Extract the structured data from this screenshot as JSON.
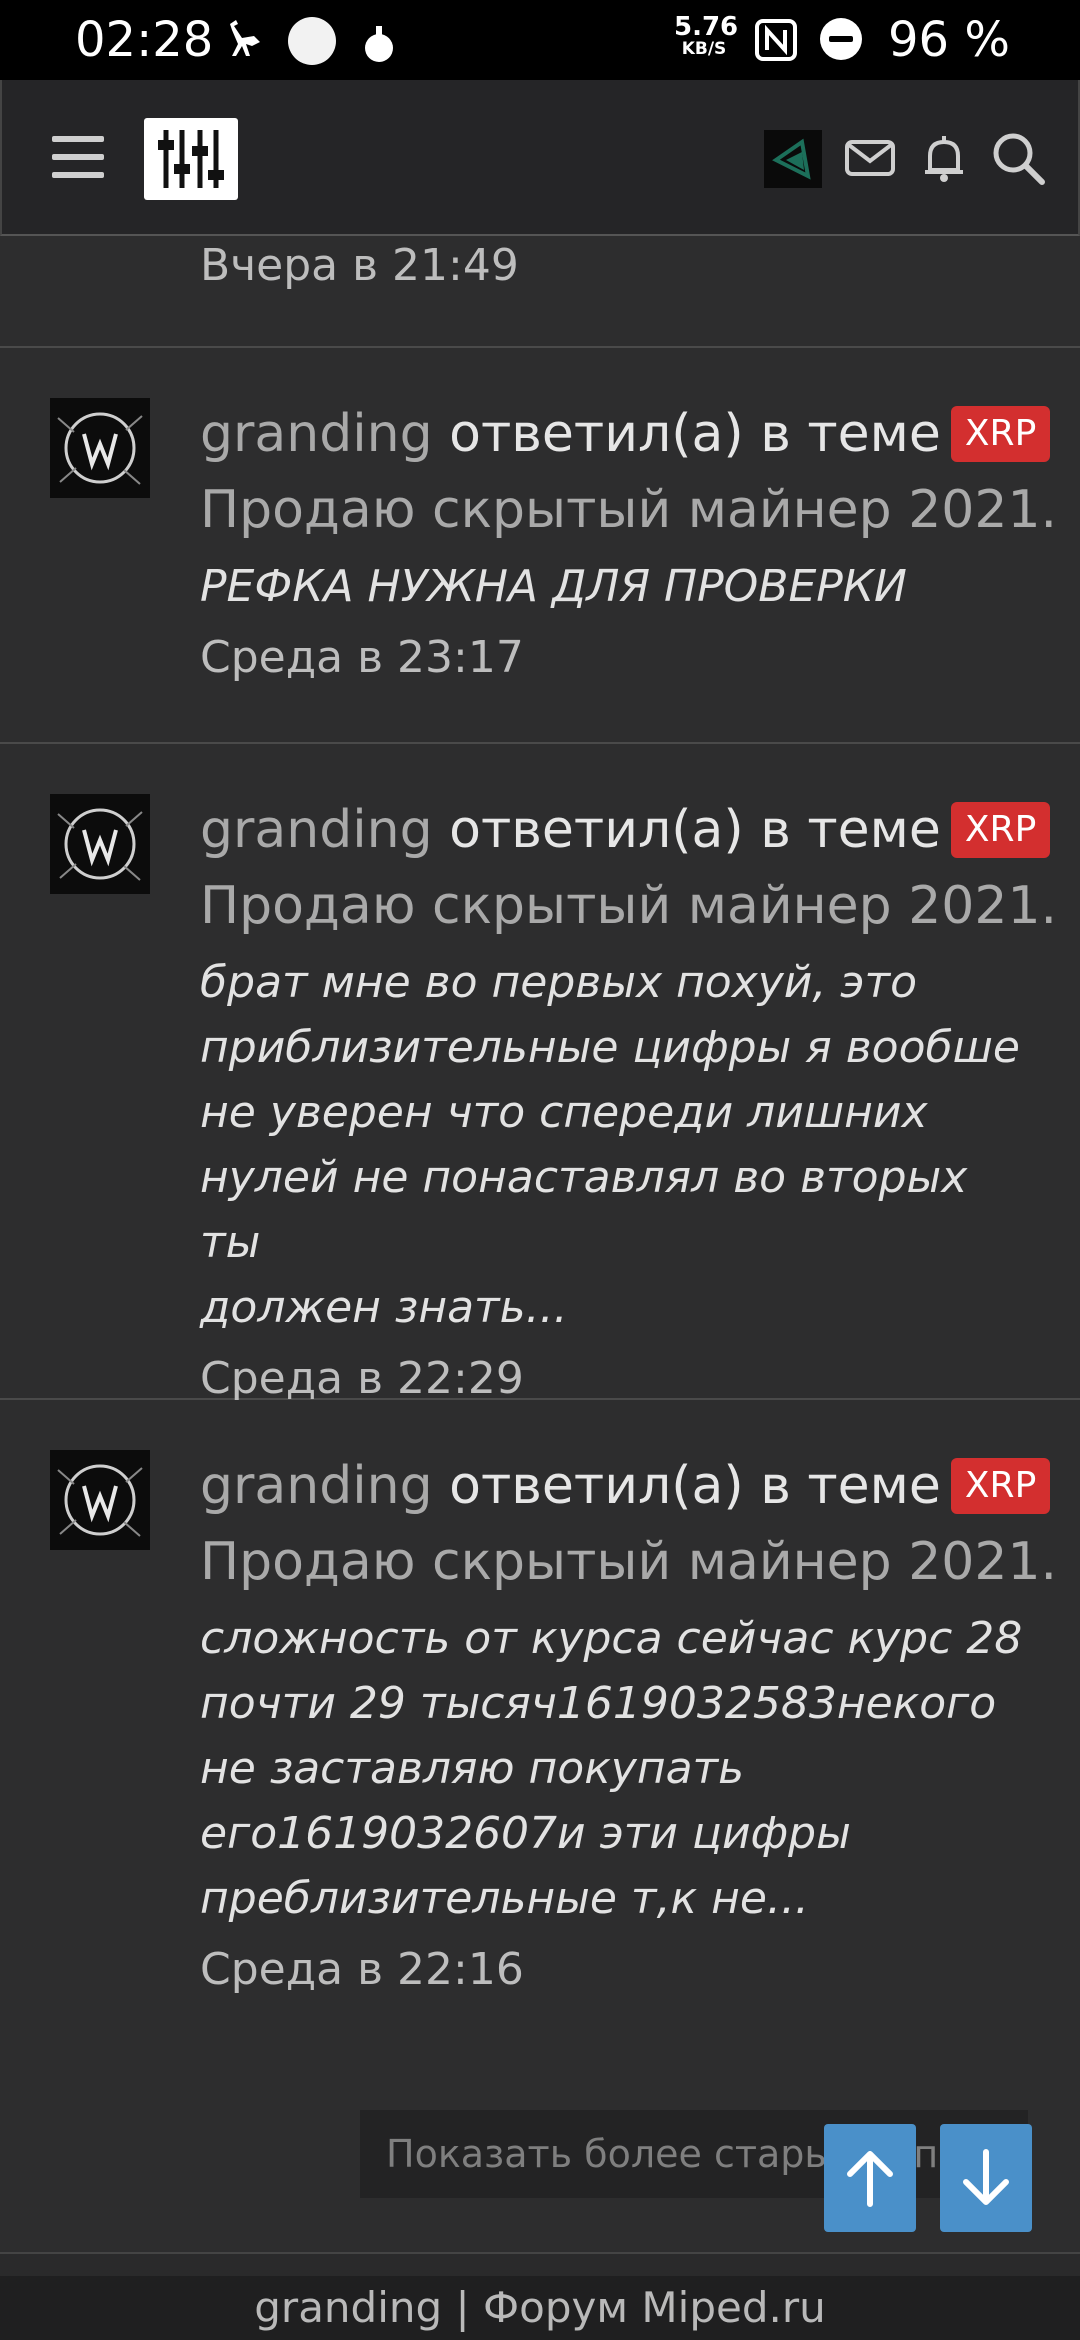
{
  "status_bar": {
    "time": "02:28",
    "net_speed_value": "5.76",
    "net_speed_unit": "KB/S",
    "battery": "96 %"
  },
  "header": {
    "menu_icon": "hamburger-icon",
    "logo_icon": "mixer-sliders-logo",
    "icons": [
      "avatar",
      "mail-icon",
      "bell-icon",
      "search-icon"
    ]
  },
  "previous_post": {
    "time": "Вчера в 21:49"
  },
  "posts": [
    {
      "user": "granding",
      "action": "ответил(а) в теме",
      "badge": "XRP",
      "thread": "Продаю скрытый майнер 2021.",
      "excerpt_lines": [
        "РЕФКА НУЖНА ДЛЯ ПРОВЕРКИ"
      ],
      "time": "Среда в 23:17"
    },
    {
      "user": "granding",
      "action": "ответил(а) в теме",
      "badge": "XRP",
      "thread": "Продаю скрытый майнер 2021.",
      "excerpt_lines": [
        "брат мне во первых похуй, это",
        "приблизительные цифры я вообше",
        "не уверен что спереди лишних",
        "нулей не понаставлял во вторых ты",
        "должен знать..."
      ],
      "time": "Среда в 22:29"
    },
    {
      "user": "granding",
      "action": "ответил(а) в теме",
      "badge": "XRP",
      "thread": "Продаю скрытый майнер 2021.",
      "excerpt_lines": [
        "сложность от курса сейчас курс 28",
        "почти 29 тысяч1619032583некого",
        "не заставляю покупать",
        "его1619032607и эти цифры",
        "преблизительные т,к не..."
      ],
      "time": "Среда в 22:16"
    }
  ],
  "load_more": {
    "label": "Показать более старые записи"
  },
  "scroll_buttons": {
    "up_icon": "arrow-up-icon",
    "down_icon": "arrow-down-icon",
    "color": "#4a90c9"
  },
  "footer": {
    "text": "granding | Форум Miped.ru"
  },
  "colors": {
    "background": "#2a2a2b",
    "badge": "#d32f2f",
    "accent": "#4a90c9"
  }
}
